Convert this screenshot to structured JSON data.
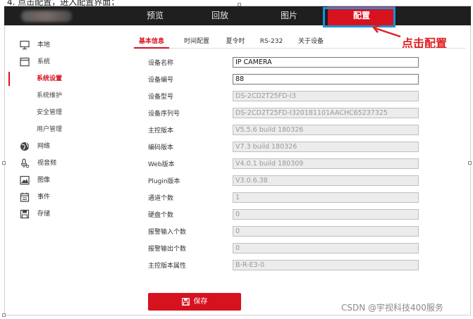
{
  "top_caption": "4. 点击配置，进入配置界面；",
  "nav": {
    "items": [
      {
        "label": "预览",
        "active": false
      },
      {
        "label": "回放",
        "active": false
      },
      {
        "label": "图片",
        "active": false
      },
      {
        "label": "配置",
        "active": true
      }
    ]
  },
  "annotation": {
    "text": "点击配置",
    "color": "#e02020"
  },
  "sidebar": {
    "items": [
      {
        "label": "本地",
        "icon": "monitor-icon"
      },
      {
        "label": "系统",
        "icon": "system-icon"
      }
    ],
    "subitems": [
      {
        "label": "系统设置",
        "active": true
      },
      {
        "label": "系统维护",
        "active": false
      },
      {
        "label": "安全管理",
        "active": false
      },
      {
        "label": "用户管理",
        "active": false
      }
    ],
    "items2": [
      {
        "label": "网络",
        "icon": "globe-icon"
      },
      {
        "label": "视音频",
        "icon": "mic-icon"
      },
      {
        "label": "图像",
        "icon": "image-icon"
      },
      {
        "label": "事件",
        "icon": "calendar-icon"
      },
      {
        "label": "存储",
        "icon": "save-icon"
      }
    ]
  },
  "tabs": [
    {
      "label": "基本信息",
      "active": true
    },
    {
      "label": "时间配置",
      "active": false
    },
    {
      "label": "夏令时",
      "active": false
    },
    {
      "label": "RS-232",
      "active": false
    },
    {
      "label": "关于设备",
      "active": false
    }
  ],
  "fields": [
    {
      "label": "设备名称",
      "value": "IP CAMERA",
      "editable": true
    },
    {
      "label": "设备编号",
      "value": "88",
      "editable": true
    },
    {
      "label": "设备型号",
      "value": "DS-2CD2T25FD-I3",
      "editable": false
    },
    {
      "label": "设备序列号",
      "value": "DS-2CD2T25FD-I320181101AACHC65237325",
      "editable": false
    },
    {
      "label": "主控版本",
      "value": "V5.5.6 build 180326",
      "editable": false
    },
    {
      "label": "编码版本",
      "value": "V7.3 build 180326",
      "editable": false
    },
    {
      "label": "Web版本",
      "value": "V4.0.1 build 180309",
      "editable": false
    },
    {
      "label": "Plugin版本",
      "value": "V3.0.6.38",
      "editable": false
    },
    {
      "label": "通道个数",
      "value": "1",
      "editable": false
    },
    {
      "label": "硬盘个数",
      "value": "0",
      "editable": false
    },
    {
      "label": "报警输入个数",
      "value": "0",
      "editable": false
    },
    {
      "label": "报警输出个数",
      "value": "0",
      "editable": false
    },
    {
      "label": "主控版本属性",
      "value": "B-R-E3-0",
      "editable": false
    }
  ],
  "save_button": {
    "label": "保存"
  },
  "watermark": "CSDN @宇视科技400服务",
  "colors": {
    "accent": "#d7121f",
    "topbar": "#1f1f1f",
    "highlight": "#1e90d8"
  }
}
